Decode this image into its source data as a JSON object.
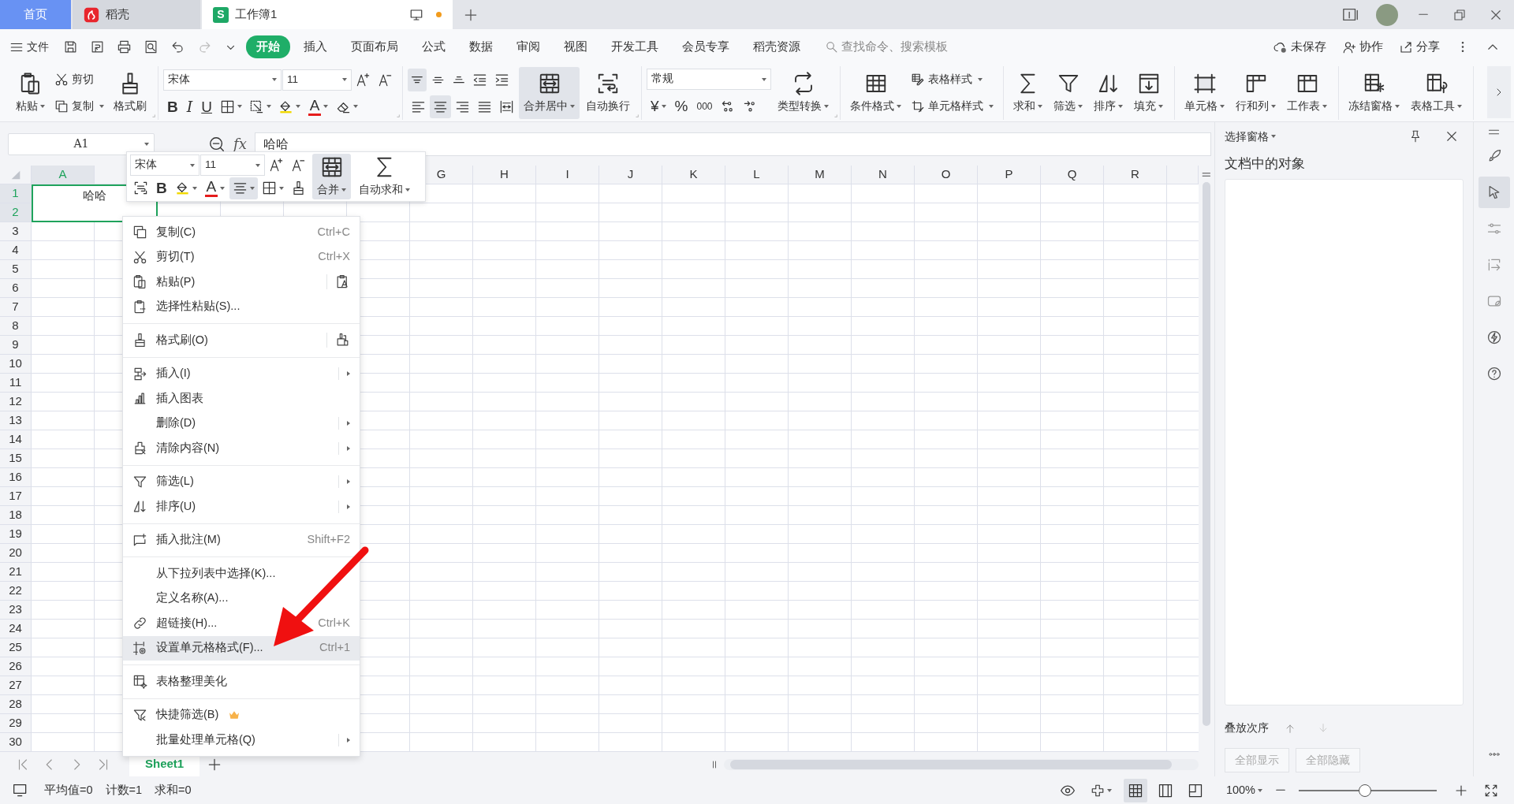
{
  "tabs": [
    {
      "label": "首页",
      "kind": "home",
      "selected": false
    },
    {
      "label": "稻壳",
      "kind": "app",
      "selected": false
    },
    {
      "label": "工作簿1",
      "kind": "doc",
      "logo": "S",
      "selected": true,
      "unsaved": true
    }
  ],
  "menu": {
    "file": "文件",
    "tabs": [
      {
        "label": "开始",
        "selected": true
      },
      {
        "label": "插入",
        "selected": false
      },
      {
        "label": "页面布局",
        "selected": false
      },
      {
        "label": "公式",
        "selected": false
      },
      {
        "label": "数据",
        "selected": false
      },
      {
        "label": "审阅",
        "selected": false
      },
      {
        "label": "视图",
        "selected": false
      },
      {
        "label": "开发工具",
        "selected": false
      },
      {
        "label": "会员专享",
        "selected": false
      },
      {
        "label": "稻壳资源",
        "selected": false
      }
    ],
    "search": {
      "placeholder": "查找命令、搜索模板"
    },
    "actions": [
      {
        "label": "未保存"
      },
      {
        "label": "协作"
      },
      {
        "label": "分享"
      }
    ]
  },
  "ribbon": [
    {
      "launcher": true,
      "cols": [
        [
          [
            {
              "kind": "large",
              "label": "粘贴",
              "dropdown": true
            }
          ]
        ],
        [
          [
            {
              "kind": "small",
              "label": "剪切"
            }
          ],
          [
            {
              "kind": "small",
              "label": "复制",
              "dropdown": true
            }
          ]
        ],
        [
          [
            {
              "kind": "large",
              "label": "格式刷"
            }
          ]
        ]
      ]
    },
    {
      "launcher": true,
      "cols": [
        [
          [
            {
              "kind": "field",
              "value": "宋体",
              "dropdown": true
            },
            {
              "kind": "field",
              "value": "11",
              "dropdown": true
            },
            {
              "kind": "icon"
            },
            {
              "kind": "icon"
            }
          ],
          [
            {
              "kind": "glyph",
              "label": "B"
            },
            {
              "kind": "glyph",
              "label": "I"
            },
            {
              "kind": "glyph",
              "label": "U"
            },
            {
              "kind": "icon",
              "dropdown": true
            },
            {
              "kind": "icon",
              "dropdown": true
            },
            {
              "kind": "icon",
              "dropdown": true
            },
            {
              "kind": "glyph",
              "label": "A",
              "dropdown": true
            },
            {
              "kind": "icon",
              "dropdown": true
            }
          ]
        ]
      ]
    },
    {
      "launcher": true,
      "cols": [
        [
          [
            {
              "kind": "icon",
              "selected": true
            },
            {
              "kind": "icon",
              "selected": false
            },
            {
              "kind": "icon",
              "selected": false
            },
            {
              "kind": "icon",
              "selected": false
            },
            {
              "kind": "icon",
              "selected": false
            }
          ],
          [
            {
              "kind": "icon",
              "selected": false
            },
            {
              "kind": "icon",
              "selected": true
            },
            {
              "kind": "icon",
              "selected": false
            },
            {
              "kind": "icon",
              "selected": false
            },
            {
              "kind": "icon",
              "selected": false
            }
          ]
        ],
        [
          [
            {
              "kind": "large",
              "label": "合并居中",
              "dropdown": true,
              "selected": true
            }
          ]
        ],
        [
          [
            {
              "kind": "large",
              "label": "自动换行",
              "selected": false
            }
          ]
        ]
      ]
    },
    {
      "launcher": true,
      "cols": [
        [
          [
            {
              "kind": "field",
              "value": "常规",
              "dropdown": true
            }
          ],
          [
            {
              "kind": "glyph",
              "label": "¥",
              "dropdown": true
            },
            {
              "kind": "glyph",
              "label": "%"
            },
            {
              "kind": "glyph",
              "label": "000"
            },
            {
              "kind": "icon"
            },
            {
              "kind": "icon"
            }
          ]
        ],
        [
          [
            {
              "kind": "large",
              "label": "类型转换",
              "dropdown": true
            }
          ]
        ]
      ]
    },
    {
      "cols": [
        [
          [
            {
              "kind": "large",
              "label": "条件格式",
              "dropdown": true
            }
          ]
        ],
        [
          [
            {
              "kind": "small",
              "label": "表格样式",
              "dropdown": true
            }
          ],
          [
            {
              "kind": "small",
              "label": "单元格样式",
              "dropdown": true
            }
          ]
        ]
      ]
    },
    {
      "cols": [
        [
          [
            {
              "kind": "large",
              "label": "求和",
              "dropdown": true
            }
          ]
        ],
        [
          [
            {
              "kind": "large",
              "label": "筛选",
              "dropdown": true
            }
          ]
        ],
        [
          [
            {
              "kind": "large",
              "label": "排序",
              "dropdown": true
            }
          ]
        ],
        [
          [
            {
              "kind": "large",
              "label": "填充",
              "dropdown": true
            }
          ]
        ]
      ]
    },
    {
      "cols": [
        [
          [
            {
              "kind": "large",
              "label": "单元格",
              "dropdown": true
            }
          ]
        ],
        [
          [
            {
              "kind": "large",
              "label": "行和列",
              "dropdown": true
            }
          ]
        ],
        [
          [
            {
              "kind": "large",
              "label": "工作表",
              "dropdown": true
            }
          ]
        ]
      ]
    },
    {
      "cols": [
        [
          [
            {
              "kind": "large",
              "label": "冻结窗格",
              "dropdown": true
            }
          ]
        ],
        [
          [
            {
              "kind": "large",
              "label": "表格工具",
              "dropdown": true
            }
          ]
        ]
      ]
    }
  ],
  "name_box": "A1",
  "formula_label": "fx",
  "formula": "哈哈",
  "sheet": {
    "columns": [
      {
        "label": "A",
        "selected": true
      },
      {
        "label": "G",
        "selected": false
      },
      {
        "label": "H",
        "selected": false
      },
      {
        "label": "I",
        "selected": false
      },
      {
        "label": "J",
        "selected": false
      },
      {
        "label": "K",
        "selected": false
      },
      {
        "label": "L",
        "selected": false
      },
      {
        "label": "M",
        "selected": false
      },
      {
        "label": "N",
        "selected": false
      },
      {
        "label": "O",
        "selected": false
      },
      {
        "label": "P",
        "selected": false
      },
      {
        "label": "Q",
        "selected": false
      },
      {
        "label": "R",
        "selected": false
      }
    ],
    "rows": [
      {
        "label": "1",
        "selected": true
      },
      {
        "label": "2",
        "selected": true
      },
      {
        "label": "3",
        "selected": false
      },
      {
        "label": "4",
        "selected": false
      },
      {
        "label": "5",
        "selected": false
      },
      {
        "label": "6",
        "selected": false
      },
      {
        "label": "7",
        "selected": false
      },
      {
        "label": "8",
        "selected": false
      },
      {
        "label": "9",
        "selected": false
      },
      {
        "label": "10",
        "selected": false
      },
      {
        "label": "11",
        "selected": false
      },
      {
        "label": "12",
        "selected": false
      },
      {
        "label": "13",
        "selected": false
      },
      {
        "label": "14",
        "selected": false
      },
      {
        "label": "15",
        "selected": false
      },
      {
        "label": "16",
        "selected": false
      },
      {
        "label": "17",
        "selected": false
      },
      {
        "label": "18",
        "selected": false
      },
      {
        "label": "19",
        "selected": false
      },
      {
        "label": "20",
        "selected": false
      },
      {
        "label": "21",
        "selected": false
      },
      {
        "label": "22",
        "selected": false
      },
      {
        "label": "23",
        "selected": false
      },
      {
        "label": "24",
        "selected": false
      },
      {
        "label": "25",
        "selected": false
      },
      {
        "label": "26",
        "selected": false
      },
      {
        "label": "27",
        "selected": false
      },
      {
        "label": "28",
        "selected": false
      },
      {
        "label": "29",
        "selected": false
      },
      {
        "label": "30",
        "selected": false
      }
    ],
    "cells": [
      {
        "text": "哈哈",
        "merged": true,
        "selected": true
      }
    ]
  },
  "mini_toolbar": {
    "cols": [
      [
        [
          {
            "kind": "field",
            "value": "宋体",
            "dropdown": true
          },
          {
            "kind": "field",
            "value": "11",
            "dropdown": true
          },
          {
            "kind": "icon"
          },
          {
            "kind": "icon"
          }
        ],
        [
          {
            "kind": "icon",
            "selected": false
          },
          {
            "kind": "glyph",
            "label": "B",
            "selected": false
          },
          {
            "kind": "icon",
            "dropdown": true,
            "selected": false
          },
          {
            "kind": "glyph",
            "label": "A",
            "dropdown": true,
            "selected": false
          },
          {
            "kind": "icon",
            "dropdown": true,
            "selected": true
          },
          {
            "kind": "icon",
            "dropdown": true,
            "selected": false
          },
          {
            "kind": "icon",
            "selected": false
          }
        ]
      ],
      [
        [
          {
            "kind": "large",
            "label": "合并",
            "dropdown": true,
            "selected": true
          }
        ]
      ],
      [
        [
          {
            "kind": "large",
            "label": "自动求和",
            "dropdown": true,
            "selected": false
          }
        ]
      ]
    ]
  },
  "context_menu": [
    {
      "kind": "item",
      "label": "复制(C)",
      "shortcut": "Ctrl+C",
      "selected": false
    },
    {
      "kind": "item",
      "label": "剪切(T)",
      "shortcut": "Ctrl+X",
      "selected": false
    },
    {
      "kind": "item",
      "label": "粘贴(P)",
      "side_button": true,
      "selected": false
    },
    {
      "kind": "item",
      "label": "选择性粘贴(S)...",
      "selected": false
    },
    {
      "kind": "separator"
    },
    {
      "kind": "item",
      "label": "格式刷(O)",
      "side_button": true,
      "selected": false
    },
    {
      "kind": "separator"
    },
    {
      "kind": "item",
      "label": "插入(I)",
      "submenu": true,
      "selected": false
    },
    {
      "kind": "item",
      "label": "插入图表",
      "selected": false
    },
    {
      "kind": "item",
      "label": "删除(D)",
      "submenu": true,
      "selected": false
    },
    {
      "kind": "item",
      "label": "清除内容(N)",
      "submenu": true,
      "selected": false
    },
    {
      "kind": "separator"
    },
    {
      "kind": "item",
      "label": "筛选(L)",
      "submenu": true,
      "selected": false
    },
    {
      "kind": "item",
      "label": "排序(U)",
      "submenu": true,
      "selected": false
    },
    {
      "kind": "separator"
    },
    {
      "kind": "item",
      "label": "插入批注(M)",
      "shortcut": "Shift+F2",
      "selected": false
    },
    {
      "kind": "separator"
    },
    {
      "kind": "item",
      "label": "从下拉列表中选择(K)...",
      "selected": false
    },
    {
      "kind": "item",
      "label": "定义名称(A)...",
      "selected": false
    },
    {
      "kind": "item",
      "label": "超链接(H)...",
      "shortcut": "Ctrl+K",
      "selected": false
    },
    {
      "kind": "item",
      "label": "设置单元格格式(F)...",
      "shortcut": "Ctrl+1",
      "selected": true
    },
    {
      "kind": "separator"
    },
    {
      "kind": "item",
      "label": "表格整理美化",
      "selected": false
    },
    {
      "kind": "separator"
    },
    {
      "kind": "item",
      "label": "快捷筛选(B)",
      "premium": true,
      "selected": false
    },
    {
      "kind": "item",
      "label": "批量处理单元格(Q)",
      "submenu": true,
      "selected": false
    }
  ],
  "sheet_tabs": [
    {
      "label": "Sheet1",
      "selected": true
    }
  ],
  "side_pane": {
    "title": "选择窗格",
    "heading": "文档中的对象",
    "order_label": "叠放次序",
    "buttons": [
      {
        "label": "全部显示",
        "disabled": true
      },
      {
        "label": "全部隐藏",
        "disabled": true
      }
    ]
  },
  "side_toolbar": [
    {
      "selected": false
    },
    {
      "selected": true
    },
    {
      "selected": false
    },
    {
      "selected": false
    },
    {
      "selected": false
    },
    {
      "selected": false
    },
    {
      "selected": false
    }
  ],
  "status_bar": {
    "stats": [
      "平均值=0",
      "计数=1",
      "求和=0"
    ],
    "views": [
      {
        "selected": true
      },
      {
        "selected": false
      },
      {
        "selected": false
      }
    ],
    "zoom": "100%",
    "zoom_slider": {
      "level": 0.48
    }
  }
}
